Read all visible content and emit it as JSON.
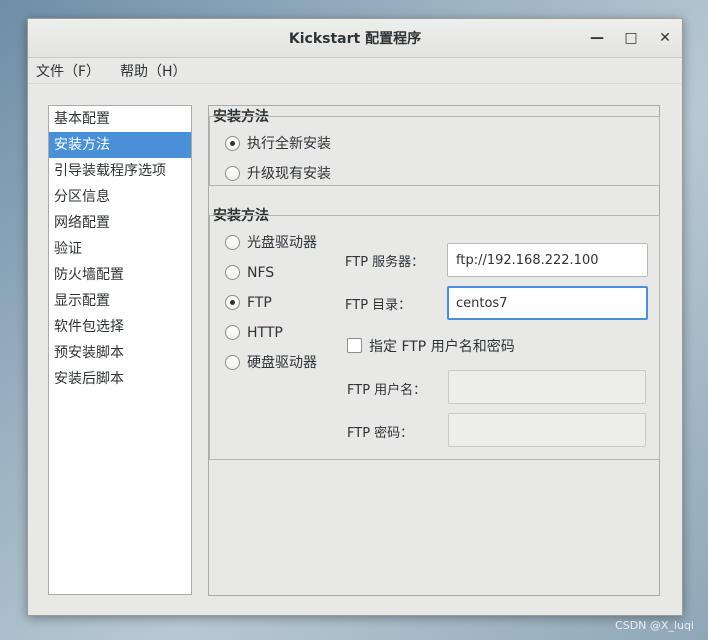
{
  "window": {
    "title": "Kickstart 配置程序",
    "controls": {
      "minimize": "—",
      "maximize": "□",
      "close": "✕"
    }
  },
  "menubar": {
    "items": [
      "文件（F）",
      "帮助（H）"
    ]
  },
  "sidebar": {
    "selected": "安装方法",
    "items": [
      "基本配置",
      "安装方法",
      "引导装载程序选项",
      "分区信息",
      "网络配置",
      "验证",
      "防火墙配置",
      "显示配置",
      "软件包选择",
      "预安装脚本",
      "安装后脚本"
    ]
  },
  "install_type": {
    "title": "安装方法",
    "options": [
      {
        "label": "执行全新安装",
        "checked": true
      },
      {
        "label": "升级现有安装",
        "checked": false
      }
    ]
  },
  "install_source": {
    "title": "安装方法",
    "options": [
      {
        "label": "光盘驱动器",
        "checked": false
      },
      {
        "label": "NFS",
        "checked": false
      },
      {
        "label": "FTP",
        "checked": true
      },
      {
        "label": "HTTP",
        "checked": false
      },
      {
        "label": "硬盘驱动器",
        "checked": false
      }
    ],
    "ftp": {
      "server_label": "FTP 服务器：",
      "server_value": "ftp://192.168.222.100",
      "dir_label": "FTP 目录：",
      "dir_value": "centos7",
      "auth_checkbox_label": "指定  FTP 用户名和密码",
      "auth_checked": false,
      "username_label": "FTP 用户名：",
      "username_value": "",
      "password_label": "FTP 密码：",
      "password_value": ""
    }
  },
  "watermark": "CSDN @X_luqi"
}
